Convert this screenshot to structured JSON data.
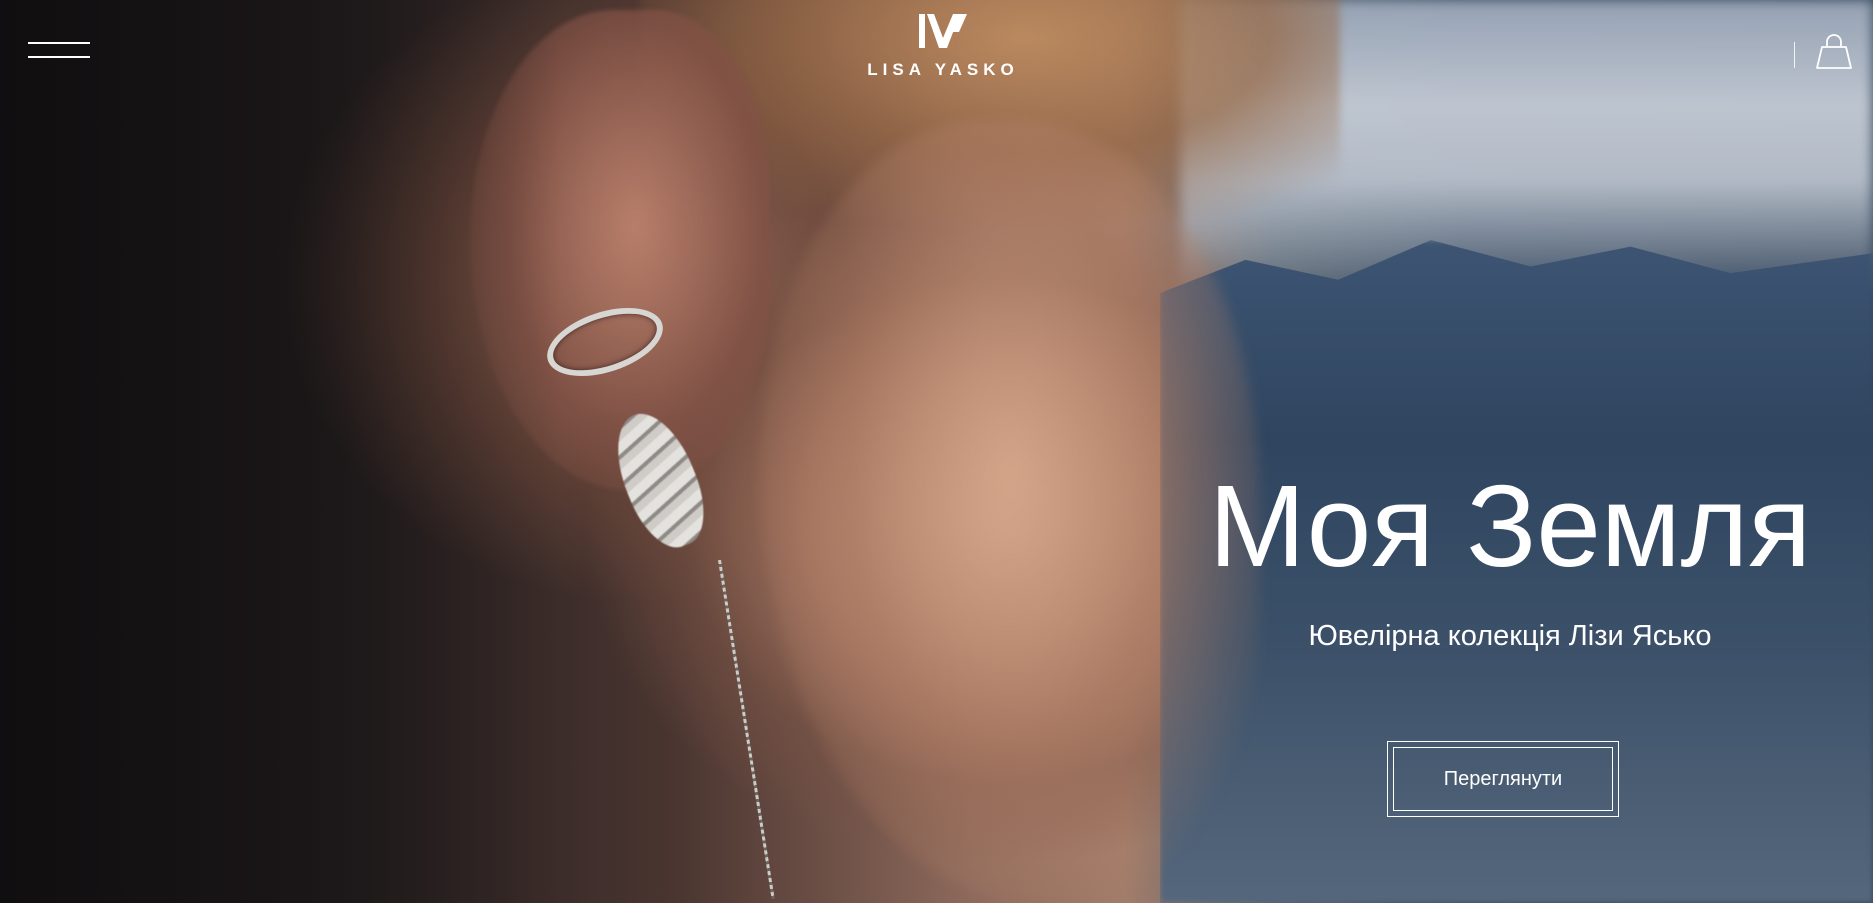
{
  "header": {
    "menu_icon": "hamburger-menu-icon",
    "logo_text": "LISA YASKO",
    "cart_icon": "shopping-bag-icon"
  },
  "hero": {
    "title": "Моя Земля",
    "subtitle": "Ювелірна колекція Лізи Ясько",
    "cta_label": "Переглянути"
  },
  "colors": {
    "text": "#ffffff",
    "accent": "#ffffff"
  }
}
